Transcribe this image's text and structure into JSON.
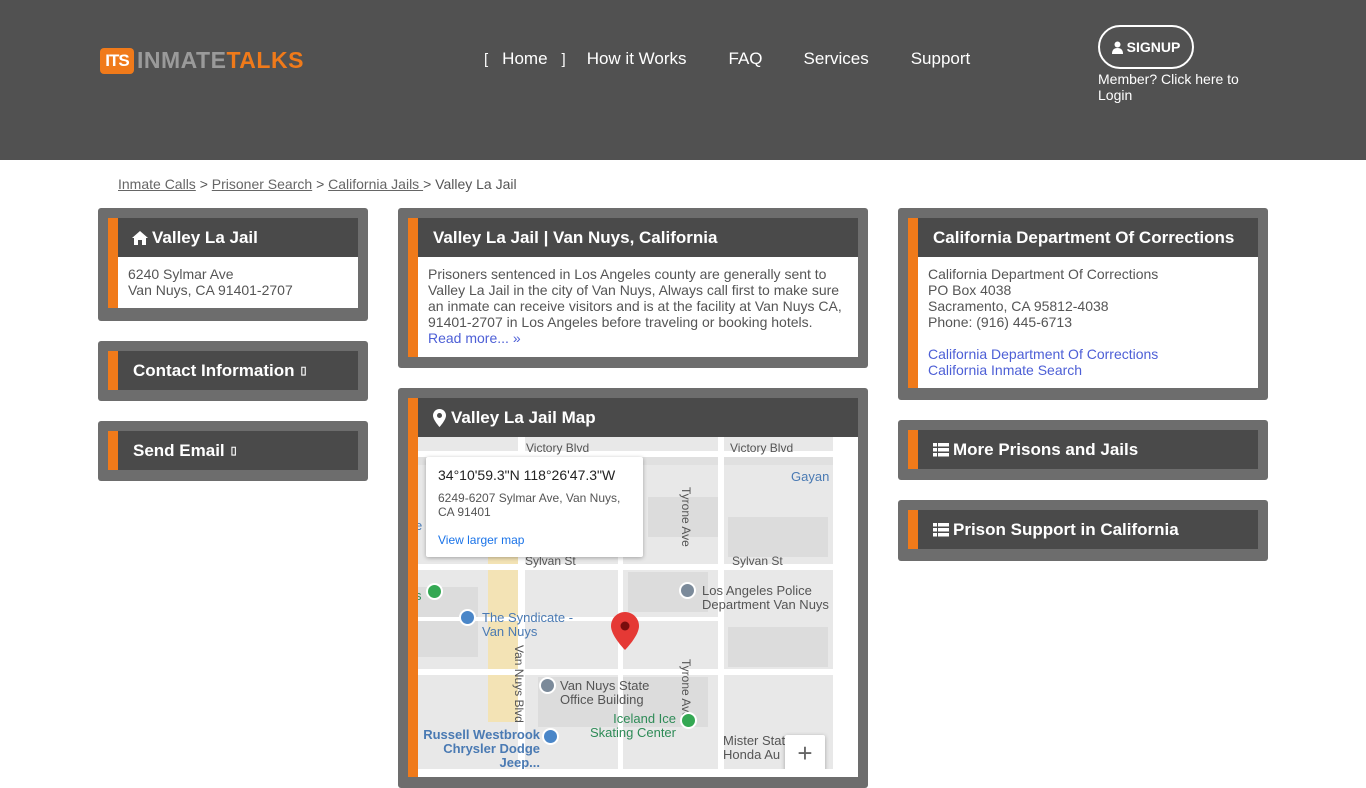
{
  "header": {
    "logo_badge": "ITS",
    "logo_word1": "INMATE",
    "logo_word2": "TALKS",
    "nav_open_bracket": "[",
    "nav_close_bracket": "]",
    "nav": [
      "Home",
      "How it Works",
      "FAQ",
      "Services",
      "Support"
    ],
    "signup_label": "SIGNUP",
    "member_text": "Member? Click here to Login"
  },
  "breadcrumb": {
    "items": [
      "Inmate Calls",
      "Prisoner Search",
      "California Jails "
    ],
    "separator": ">",
    "current": "Valley La Jail"
  },
  "left": {
    "address_title": "Valley La Jail",
    "address_line1": "6240 Sylmar Ave",
    "address_line2": "Van Nuys, CA 91401-2707",
    "contact_title": "Contact Information",
    "send_email_title": "Send Email",
    "toggle_glyph": "▯"
  },
  "center": {
    "about_title": "Valley La Jail | Van Nuys, California",
    "about_text": "Prisoners sentenced in Los Angeles county are generally sent to Valley La Jail in the city of Van Nuys, Always call first to make sure an inmate can receive visitors and is at the facility at Van Nuys CA, 91401-2707 in Los Angeles before traveling or booking hotels.",
    "read_more": "Read more... »",
    "map_title": "Valley La Jail Map",
    "map": {
      "info_coord": "34°10'59.3\"N 118°26'47.3\"W",
      "info_address": "6249-6207 Sylmar Ave, Van Nuys, CA 91401",
      "info_link": "View larger map",
      "street_victory_1": "Victory Blvd",
      "street_victory_2": "Victory Blvd",
      "street_tyrone_1": "Tyrone Ave",
      "street_tyrone_2": "Tyrone Ave",
      "street_sylvan_1": "Sylvan St",
      "street_sylvan_2": "Sylvan St",
      "street_vannuys": "Van Nuys Blvd",
      "poi_gayan": "Gayan",
      "poi_lapd": "Los Angeles Police Department Van Nuys",
      "poi_syndicate": "The Syndicate - Van Nuys",
      "poi_state": "Van Nuys State Office Building",
      "poi_iceland": "Iceland Ice Skating Center",
      "poi_russell": "Russell Westbrook Chrysler Dodge Jeep...",
      "poi_mister": "Mister Station - Honda Au",
      "edge_s": "s",
      "edge_e": "e",
      "zoom_in": "+"
    }
  },
  "right": {
    "cdc_title": "California Department Of Corrections",
    "cdc_name": "California Department Of Corrections",
    "cdc_po": "PO Box 4038",
    "cdc_city": "Sacramento, CA 95812-4038",
    "cdc_phone": "Phone: (916) 445-6713",
    "cdc_link1": "California Department Of Corrections",
    "cdc_link2": "California Inmate Search",
    "more_title": "More Prisons and Jails",
    "support_title": "Prison Support in California"
  },
  "colors": {
    "accent": "#f07a1a",
    "header_bg": "#515151",
    "panel_bg": "#6d6d6d",
    "box_head": "#4a4a4a",
    "link": "#4d5fd6"
  }
}
